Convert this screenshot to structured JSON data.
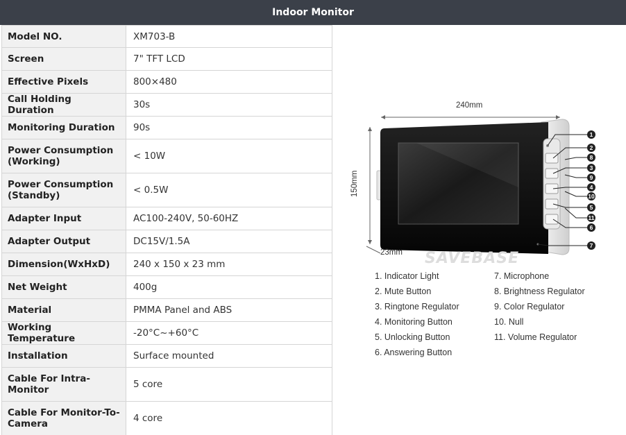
{
  "header": {
    "title": "Indoor Monitor"
  },
  "specs": [
    {
      "label": "Model NO.",
      "value": "XM703-B"
    },
    {
      "label": "Screen",
      "value": "7\" TFT LCD"
    },
    {
      "label": "Effective Pixels",
      "value": "800×480"
    },
    {
      "label": "Call Holding Duration",
      "value": "30s"
    },
    {
      "label": "Monitoring Duration",
      "value": "90s"
    },
    {
      "label": "Power Consumption (Working)",
      "value": "< 10W"
    },
    {
      "label": "Power Consumption (Standby)",
      "value": "< 0.5W"
    },
    {
      "label": "Adapter Input",
      "value": "AC100-240V, 50-60HZ"
    },
    {
      "label": "Adapter Output",
      "value": "DC15V/1.5A"
    },
    {
      "label": "Dimension(WxHxD)",
      "value": "240 x 150 x 23 mm"
    },
    {
      "label": "Net Weight",
      "value": "400g"
    },
    {
      "label": "Material",
      "value": "PMMA Panel and ABS"
    },
    {
      "label": "Working Temperature",
      "value": "-20°C~+60°C"
    },
    {
      "label": "Installation",
      "value": "Surface mounted"
    },
    {
      "label": "Cable For Intra-Monitor",
      "value": "5 core"
    },
    {
      "label": "Cable For Monitor-To-Camera",
      "value": "4 core"
    }
  ],
  "diagram": {
    "width_label": "240mm",
    "height_label": "150mm",
    "depth_label": "23mm",
    "watermark": "SAVEBASE",
    "callouts": [
      "1",
      "2",
      "8",
      "3",
      "9",
      "4",
      "10",
      "5",
      "11",
      "6",
      "7"
    ]
  },
  "legend": {
    "left": [
      "1. Indicator Light",
      "2. Mute Button",
      "3. Ringtone Regulator",
      "4. Monitoring Button",
      "5. Unlocking Button",
      "6. Answering Button"
    ],
    "right": [
      "7. Microphone",
      "8. Brightness Regulator",
      "9. Color Regulator",
      "10. Null",
      "11. Volume Regulator"
    ]
  }
}
